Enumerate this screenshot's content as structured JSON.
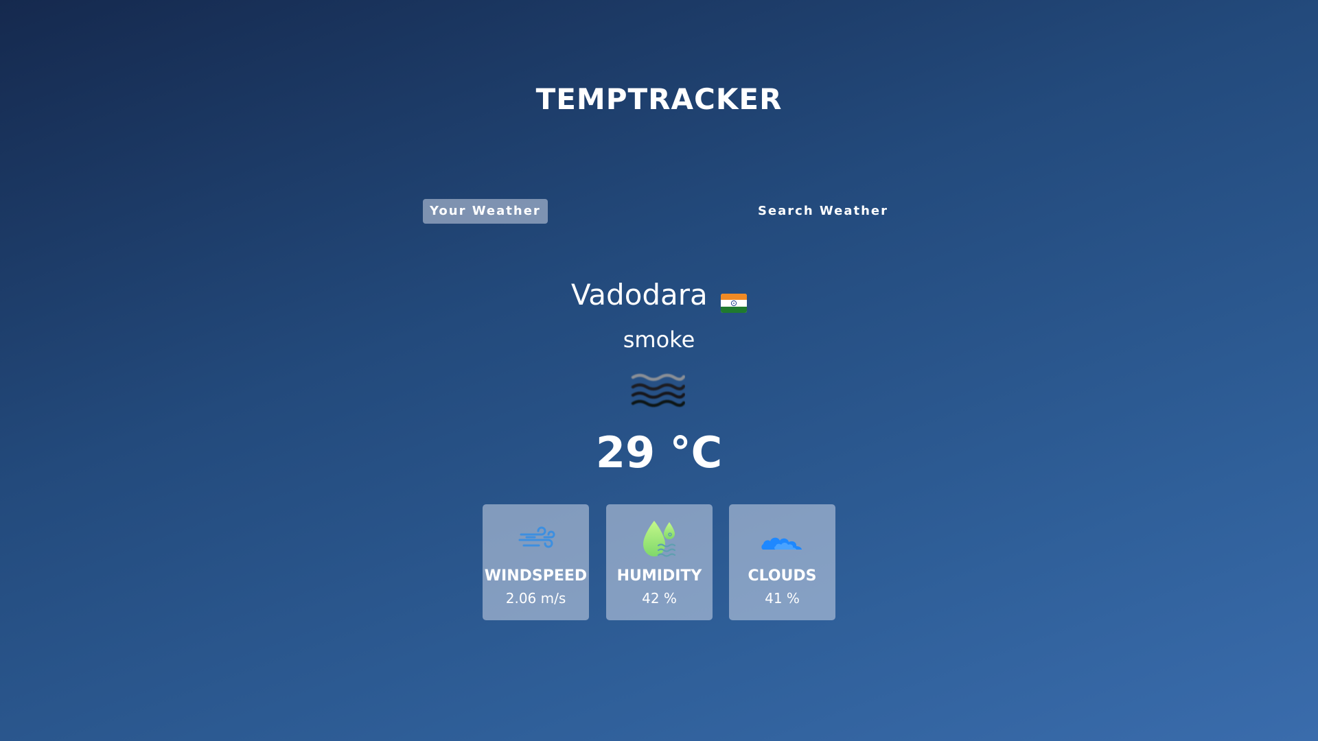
{
  "app": {
    "title": "TEMPTRACKER"
  },
  "tabs": [
    {
      "label": "Your Weather",
      "active": true
    },
    {
      "label": "Search Weather",
      "active": false
    }
  ],
  "weather": {
    "city": "Vadodara",
    "country_flag_icon": "india-flag-icon",
    "description": "smoke",
    "condition_icon": "smoke-haze-icon",
    "temperature": "29 °C"
  },
  "stats": [
    {
      "label": "WINDSPEED",
      "value": "2.06 m/s",
      "icon": "wind-icon"
    },
    {
      "label": "HUMIDITY",
      "value": "42 %",
      "icon": "humidity-icon"
    },
    {
      "label": "CLOUDS",
      "value": "41 %",
      "icon": "cloud-icon"
    }
  ],
  "colors": {
    "background_top": "#15294e",
    "background_bottom": "#3a6cac",
    "card_background": "#dbe2ef",
    "wind_icon": "#3d8fe0",
    "humidity_icon": "#a3f07a",
    "cloud_icon": "#1e88ff"
  }
}
